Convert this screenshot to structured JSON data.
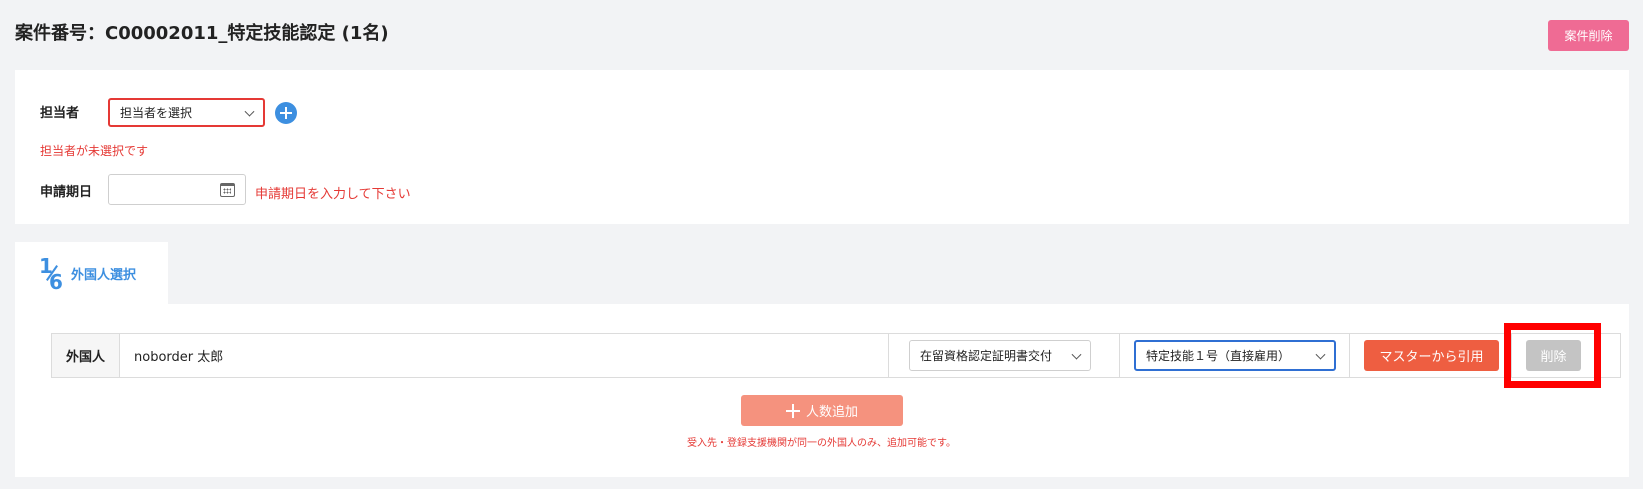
{
  "header": {
    "title": "案件番号：C00002011_特定技能認定 (1名)",
    "case_delete_label": "案件削除"
  },
  "assignment": {
    "assignee_label": "担当者",
    "assignee_select_value": "担当者を選択",
    "assignee_error": "担当者が未選択です",
    "application_date_label": "申請期日",
    "application_date_value": "",
    "application_date_error": "申請期日を入力して下さい"
  },
  "tab": {
    "step_numerator": "1",
    "step_denominator": "6",
    "label": "外国人選択"
  },
  "foreigner_row": {
    "label": "外国人",
    "name": "noborder 太郎",
    "status_select_value": "在留資格認定証明書交付",
    "visa_select_value": "特定技能１号（直接雇用）",
    "master_button_label": "マスターから引用",
    "delete_button_label": "削除"
  },
  "add_people_label": "人数追加",
  "note": "受入先・登録支援機関が同一の外国人のみ、追加可能です。",
  "colors": {
    "accent_blue": "#3d8fe0",
    "error_red": "#e53935",
    "case_delete_pink": "#ef6b94",
    "master_orange": "#ee5e41",
    "add_salmon": "#f5927e",
    "highlight_red": "#ff0000"
  }
}
